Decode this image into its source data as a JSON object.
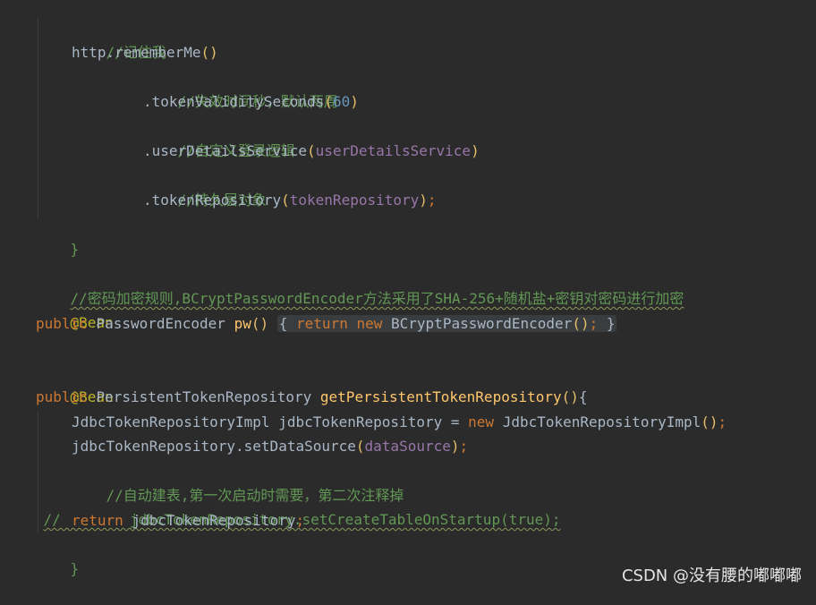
{
  "code": {
    "line1_comment": "//记住我",
    "line2_obj": "http.",
    "line2_method": "rememberMe",
    "line3_comment": "//失效时间秒，默认两周",
    "line4_method": ".tokenValiditySeconds",
    "line4_arg": "60",
    "line5_comment": "//自定义登录逻辑",
    "line6_method": ".userDetailsService",
    "line6_arg": "userDetailsService",
    "line7_comment": "//持久层对象",
    "line8_method": ".tokenRepository",
    "line8_arg": "tokenRepository",
    "line9_brace": "}",
    "line10_comment": "//密码加密规则,BCryptPasswordEncoder方法采用了SHA-256+随机盐+密钥对密码进行加密",
    "line11_ann": "@Bean",
    "line12_kw": "public",
    "line12_type": "PasswordEncoder",
    "line12_name": "pw",
    "line12_return": "return",
    "line12_new": "new",
    "line12_ctor": "BCryptPasswordEncoder",
    "line13_ann": "@Bean",
    "line14_kw": "public",
    "line14_type": "PersistentTokenRepository",
    "line14_name": "getPersistentTokenRepository",
    "line15_type": "JdbcTokenRepositoryImpl",
    "line15_var": "jdbcTokenRepository",
    "line15_new": "new",
    "line15_ctor": "JdbcTokenRepositoryImpl",
    "line16_call": "jdbcTokenRepository.setDataSource",
    "line16_arg": "dataSource",
    "line17_comment": "//自动建表,第一次启动时需要，第二次注释掉",
    "line18_comment": "//        jdbcTokenRepository.setCreateTableOnStartup(true);",
    "line19_kw": "return",
    "line19_var": "jdbcTokenRepository",
    "line20_brace": "}"
  },
  "watermark": "CSDN @没有腰的嘟嘟嘟",
  "colors": {
    "background": "#2b2b2b",
    "comment": "#629755",
    "keyword": "#cc7832",
    "annotation": "#bbb529",
    "method": "#ffc66d",
    "number": "#6897bb",
    "field": "#9876aa",
    "plain": "#a9b7c6"
  }
}
